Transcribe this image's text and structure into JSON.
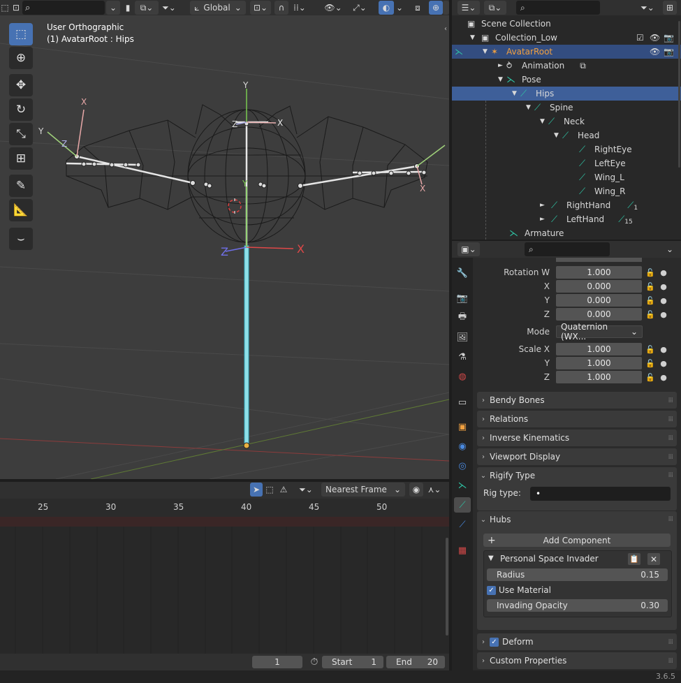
{
  "header": {
    "search_placeholder": "",
    "orientation": "Global",
    "snap_icons": [
      "magnet-icon",
      "grid-icon"
    ]
  },
  "viewport": {
    "title": "User Orthographic",
    "subtitle": "(1) AvatarRoot : Hips",
    "axes": {
      "x": "X",
      "y": "Y",
      "z": "Z"
    }
  },
  "timeline": {
    "snap_mode": "Nearest Frame",
    "ruler": [
      "25",
      "30",
      "35",
      "40",
      "45",
      "50"
    ],
    "current_frame": "1",
    "start_label": "Start",
    "start_value": "1",
    "end_label": "End",
    "end_value": "20"
  },
  "outliner": {
    "rows": [
      {
        "label": "Scene Collection"
      },
      {
        "label": "Collection_Low"
      },
      {
        "label": "AvatarRoot"
      },
      {
        "label": "Animation"
      },
      {
        "label": "Pose"
      },
      {
        "label": "Hips"
      },
      {
        "label": "Spine"
      },
      {
        "label": "Neck"
      },
      {
        "label": "Head"
      },
      {
        "label": "RightEye"
      },
      {
        "label": "LeftEye"
      },
      {
        "label": "Wing_L"
      },
      {
        "label": "Wing_R"
      },
      {
        "label": "RightHand",
        "badge": "1"
      },
      {
        "label": "LeftHand",
        "badge": "15"
      },
      {
        "label": "Armature"
      }
    ]
  },
  "properties": {
    "rotation_w_label": "Rotation W",
    "rotation_w": "1.000",
    "rx_label": "X",
    "rx": "0.000",
    "ry_label": "Y",
    "ry": "0.000",
    "rz_label": "Z",
    "rz": "0.000",
    "mode_label": "Mode",
    "mode_value": "Quaternion (WX...",
    "scale_x_label": "Scale X",
    "scale_x": "1.000",
    "sy_label": "Y",
    "sy": "1.000",
    "sz_label": "Z",
    "sz": "1.000",
    "panels": {
      "bendy": "Bendy Bones",
      "relations": "Relations",
      "ik": "Inverse Kinematics",
      "viewport_display": "Viewport Display",
      "rigify": "Rigify Type",
      "hubs": "Hubs",
      "deform": "Deform",
      "custom": "Custom Properties"
    },
    "rig_type_label": "Rig type:",
    "rig_type_value": "•",
    "add_component": "Add Component",
    "component_title": "Personal Space Invader",
    "radius_label": "Radius",
    "radius_value": "0.15",
    "use_material": "Use Material",
    "invading_label": "Invading Opacity",
    "invading_value": "0.30"
  },
  "status": {
    "version": "3.6.5"
  }
}
